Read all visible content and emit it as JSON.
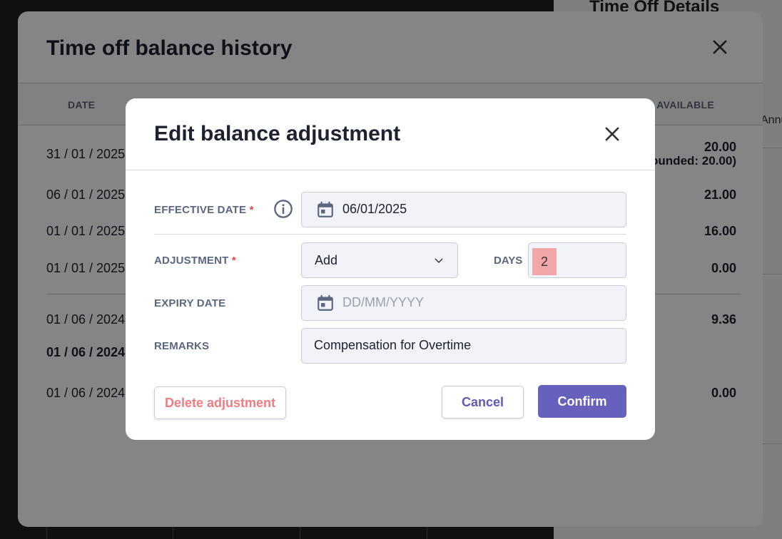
{
  "side_panel": {
    "title": "Time Off Details",
    "snippet": "Annu"
  },
  "history": {
    "title": "Time off balance history",
    "columns": {
      "date": "DATE",
      "available": "S AVAILABLE"
    },
    "rows": [
      {
        "date": "31 / 01 / 2025",
        "value": "20.00",
        "note": "ounded: 20.00)",
        "bold": false
      },
      {
        "date": "06 / 01 / 2025",
        "value": "21.00",
        "bold": false
      },
      {
        "date": "01 / 01 / 2025",
        "value": "16.00",
        "bold": false
      },
      {
        "date": "01 / 01 / 2025",
        "value": "0.00",
        "bold": false
      },
      {
        "date": "01 / 06 / 2024",
        "value": "9.36",
        "bold": false
      },
      {
        "date": "01 / 06 / 2024",
        "value": "",
        "bold": true
      },
      {
        "date": "01 / 06 / 2024",
        "value": "0.00",
        "bold": false
      }
    ]
  },
  "edit_modal": {
    "title": "Edit balance adjustment",
    "effective_date": {
      "label": "EFFECTIVE DATE",
      "required": "*",
      "value": "06/01/2025"
    },
    "adjustment": {
      "label": "ADJUSTMENT",
      "required": "*",
      "selected": "Add"
    },
    "days": {
      "label": "DAYS",
      "value": "2"
    },
    "expiry_date": {
      "label": "EXPIRY DATE",
      "value": "",
      "placeholder": "DD/MM/YYYY"
    },
    "remarks": {
      "label": "REMARKS",
      "value": "Compensation for Overtime"
    },
    "buttons": {
      "delete": "Delete adjustment",
      "cancel": "Cancel",
      "confirm": "Confirm"
    }
  },
  "colors": {
    "primary": "#6661bd",
    "danger_text": "#ee7c80",
    "required": "#e5484d",
    "days_highlight": "#f2a6a7"
  },
  "icons": {
    "info": "info-circle-icon",
    "calendar": "calendar-icon",
    "close": "close-icon",
    "chevron": "chevron-down-icon"
  }
}
